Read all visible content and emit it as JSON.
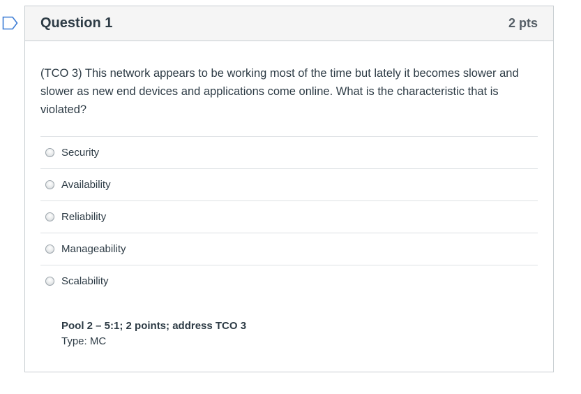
{
  "question": {
    "title": "Question 1",
    "points": "2 pts",
    "text": "(TCO 3) This network appears to be working most of the time but lately it becomes slower and slower as new end devices and applications come online. What is the characteristic that is violated?"
  },
  "answers": [
    {
      "label": "Security"
    },
    {
      "label": "Availability"
    },
    {
      "label": "Reliability"
    },
    {
      "label": "Manageability"
    },
    {
      "label": "Scalability"
    }
  ],
  "meta": {
    "pool": "Pool 2 – 5:1; 2 points; address TCO 3",
    "type": "Type: MC"
  },
  "icons": {
    "flag": "flag-outline-icon",
    "radio": "radio-unselected-icon"
  },
  "colors": {
    "flag": "#3a7bd5",
    "header_bg": "#f5f5f5",
    "border": "#c7cdd1",
    "text": "#2d3b45"
  }
}
